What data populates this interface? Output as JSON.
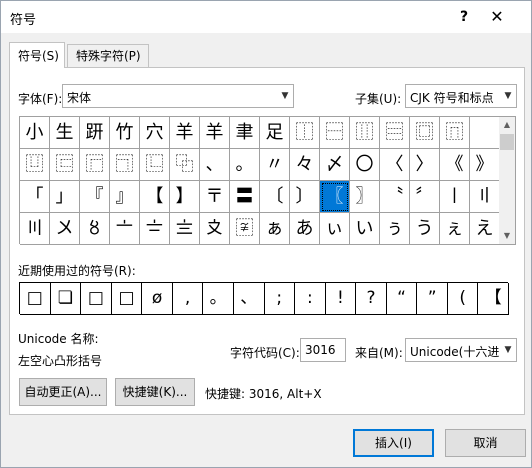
{
  "window": {
    "title": "符号",
    "help_label": "?",
    "close_label": "✕"
  },
  "tabs": [
    {
      "label": "符号(S)"
    },
    {
      "label": "特殊字符(P)"
    }
  ],
  "font": {
    "label": "字体(F):",
    "value": "宋体"
  },
  "subset": {
    "label": "子集(U):",
    "value": "CJK 符号和标点"
  },
  "symbols": [
    [
      "小",
      "生",
      "趼",
      "竹",
      "穴",
      "羊",
      "羊",
      "聿",
      "足",
      "⿰",
      "⿱",
      "⿲",
      "⿳",
      "⿴",
      "⿵"
    ],
    [
      "⿶",
      "⿷",
      "⿸",
      "⿹",
      "⿺",
      "⿻",
      "、",
      "。",
      "〃",
      "々",
      "〆",
      "〇",
      "〈",
      "〉",
      "《",
      "》"
    ],
    [
      "「",
      "」",
      "『",
      "』",
      "【",
      "】",
      "〒",
      "〓",
      "〔",
      "〕",
      "〖",
      "〗",
      "〝",
      "〞",
      "〡",
      "〢"
    ],
    [
      "〣",
      "〤",
      "〥",
      "〦",
      "〧",
      "〨",
      "〩",
      "〾",
      "ぁ",
      "あ",
      "ぃ",
      "い",
      "ぅ",
      "う",
      "ぇ",
      "え"
    ]
  ],
  "recent": {
    "label": "近期使用过的符号(R):",
    "symbols": [
      "□",
      "❏",
      "□",
      "□",
      "ø",
      ",",
      "。",
      "、",
      ";",
      ":",
      "!",
      "?",
      "“",
      "”",
      "(",
      "【"
    ]
  },
  "unicode_name": {
    "label": "Unicode 名称:",
    "value": "左空心凸形括号"
  },
  "char_code": {
    "label": "字符代码(C):",
    "value": "3016"
  },
  "from": {
    "label": "来自(M):",
    "value": "Unicode(十六进制)"
  },
  "buttons": {
    "autocorrect": "自动更正(A)...",
    "shortcut": "快捷键(K)...",
    "shortcut_info": "快捷键: 3016, Alt+X",
    "insert": "插入(I)",
    "cancel": "取消"
  }
}
